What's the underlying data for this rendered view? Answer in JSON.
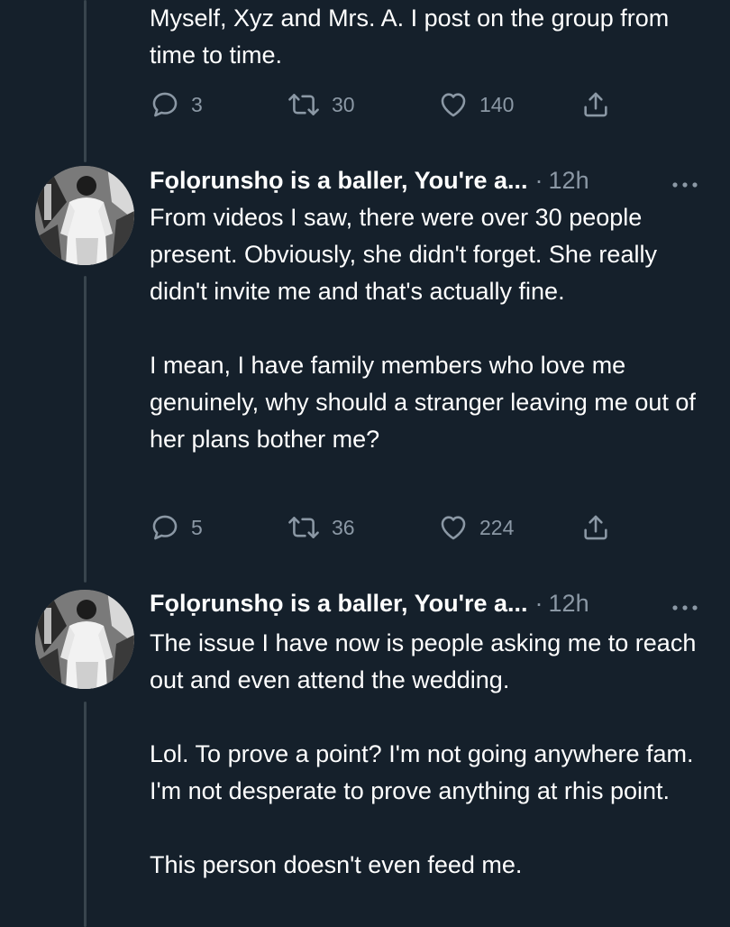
{
  "tweets": [
    {
      "text": [
        "Myself, Xyz and Mrs. A. I post on the group from time to time."
      ],
      "replies": "3",
      "retweets": "30",
      "likes": "140"
    },
    {
      "author": "Fọlọrunshọ is a baller, You're a...",
      "separator": "·",
      "time": "12h",
      "text": [
        "From videos I saw, there were over 30 people present. Obviously, she didn't forget.  She really didn't invite me and that's actually fine.",
        "I mean, I have family members who love me genuinely,  why should a stranger leaving me out of her plans bother me?"
      ],
      "replies": "5",
      "retweets": "36",
      "likes": "224"
    },
    {
      "author": "Fọlọrunshọ is a baller, You're a...",
      "separator": "·",
      "time": "12h",
      "text": [
        "The issue I have now is people asking me to reach out and even attend the wedding.",
        "Lol. To prove a point? I'm not going anywhere fam. I'm not desperate to prove anything at rhis point.",
        "This person doesn't even feed me."
      ]
    }
  ],
  "icons": {
    "reply": "speech-bubble",
    "retweet": "two-arrows-loop",
    "like": "heart-outline",
    "share": "arrow-up-from-tray",
    "more": "three-dots"
  },
  "colors": {
    "background": "#15202b",
    "text": "#ffffff",
    "muted": "#8b98a5",
    "thread_line": "#38444d"
  }
}
